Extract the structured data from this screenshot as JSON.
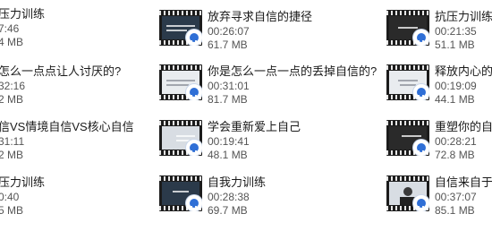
{
  "col1": [
    {
      "title": "压力训练",
      "duration": "7:46",
      "size": "4 MB"
    },
    {
      "title": "怎么一点点让人讨厌的?",
      "duration": "32:16",
      "size": "2 MB"
    },
    {
      "title": "信VS情境自信VS核心自信",
      "duration": "31:11",
      "size": "2 MB"
    },
    {
      "title": "压力训练",
      "duration": "0:40",
      "size": "5 MB"
    }
  ],
  "col2": [
    {
      "title": "放弃寻求自信的捷径",
      "duration": "00:26:07",
      "size": "61.7 MB",
      "thumb": "video-thumbnail-icon"
    },
    {
      "title": "你是怎么一点一点的丢掉自信的?",
      "duration": "00:31:01",
      "size": "81.7 MB",
      "thumb": "video-thumbnail-icon"
    },
    {
      "title": "学会重新爱上自己",
      "duration": "00:19:41",
      "size": "48.1 MB",
      "thumb": "video-thumbnail-icon"
    },
    {
      "title": "自我力训练",
      "duration": "00:28:38",
      "size": "69.7 MB",
      "thumb": "video-thumbnail-icon"
    }
  ],
  "col3": [
    {
      "title": "抗压力训练",
      "duration": "00:21:35",
      "size": "51.1 MB",
      "thumb": "video-thumbnail-icon"
    },
    {
      "title": "释放内心的力",
      "duration": "00:19:09",
      "size": "44.1 MB",
      "thumb": "video-thumbnail-icon"
    },
    {
      "title": "重塑你的自我",
      "duration": "00:28:21",
      "size": "72.8 MB",
      "thumb": "video-thumbnail-icon"
    },
    {
      "title": "自信来自于哪",
      "duration": "00:37:07",
      "size": "85.1 MB",
      "thumb": "video-thumbnail-icon"
    }
  ]
}
